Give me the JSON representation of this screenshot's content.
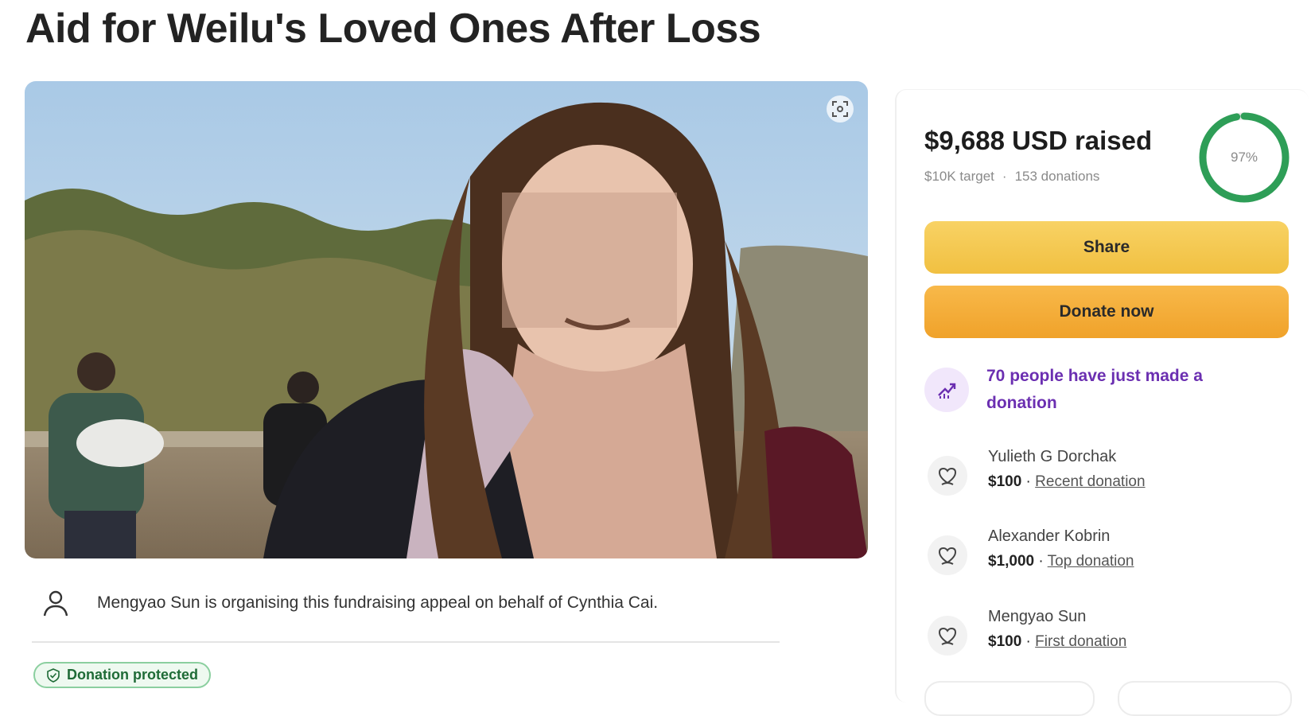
{
  "page": {
    "title": "Aid for Weilu's Loved Ones After Loss"
  },
  "hero": {
    "expand_icon": "expand-icon"
  },
  "organiser": {
    "icon": "person-icon",
    "text": "Mengyao Sun is organising this fundraising appeal on behalf of Cynthia Cai."
  },
  "badge": {
    "icon": "shield-check-icon",
    "label": "Donation protected"
  },
  "summary": {
    "raised": "$9,688 USD raised",
    "target": "$10K target",
    "separator": "·",
    "donations": "153 donations",
    "progress_label": "97%",
    "progress_fraction": 0.97,
    "progress_color": "#2e9e57"
  },
  "actions": {
    "share_label": "Share",
    "donate_label": "Donate now"
  },
  "trend": {
    "icon": "trending-up-icon",
    "text": "70 people have just made a donation"
  },
  "donors": [
    {
      "name": "Yulieth G Dorchak",
      "amount": "$100",
      "separator": " · ",
      "tag": "Recent donation",
      "icon": "donor-heart-icon"
    },
    {
      "name": "Alexander Kobrin",
      "amount": "$1,000",
      "separator": " · ",
      "tag": "Top donation",
      "icon": "donor-heart-icon"
    },
    {
      "name": "Mengyao Sun",
      "amount": "$100",
      "separator": " · ",
      "tag": "First donation",
      "icon": "donor-heart-icon"
    }
  ],
  "colors": {
    "share_button": "#f4c64f",
    "donate_button": "#f4ad3a",
    "trend_text": "#6b2fb1",
    "protected_text": "#1f6b37"
  }
}
